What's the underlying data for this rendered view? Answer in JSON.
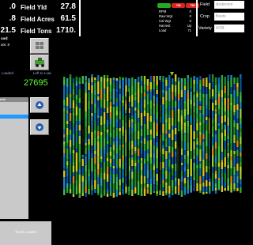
{
  "stats": {
    "left_values": [
      ".0",
      ".8",
      "21.5"
    ],
    "field_yld_label": "Field Yld",
    "field_yld_value": "27.8",
    "field_acres_label": "Field Acres",
    "field_acres_value": "61.5",
    "field_tons_label": "Field Tons",
    "field_tons_value": "1710."
  },
  "status": {
    "pills": [
      "",
      "YM",
      "TM"
    ],
    "pill_colors": [
      "#22aa22",
      "#dd2222",
      "#dd2222"
    ],
    "labels": [
      "RPM",
      "Raw Wgt",
      "Cal Wgt",
      "Harvest",
      "Load"
    ],
    "values": [
      "0",
      "0",
      "0",
      "Up",
      "71"
    ]
  },
  "info": {
    "field_label": "Field",
    "field_value": "Anderson",
    "crop_label": "Crop",
    "crop_value": "Beets",
    "variety_label": "Variety",
    "variety_value": "AOB"
  },
  "left_panel": {
    "load_label": "oad:",
    "trucks_label": "ats: 8",
    "loaded_label": "Loaded",
    "left_to_load_label": "Left to Load",
    "left_to_load_value": "27695",
    "truck_header": "uck",
    "truck_loaded_button": "Truck Loaded"
  },
  "colors": {
    "accent_green": "#66ff33",
    "selection_blue": "#2299ff"
  },
  "icons": [
    "grid-icon",
    "harvester-icon",
    "up-arrow-icon",
    "down-arrow-icon",
    "marker-triangle-icon"
  ]
}
